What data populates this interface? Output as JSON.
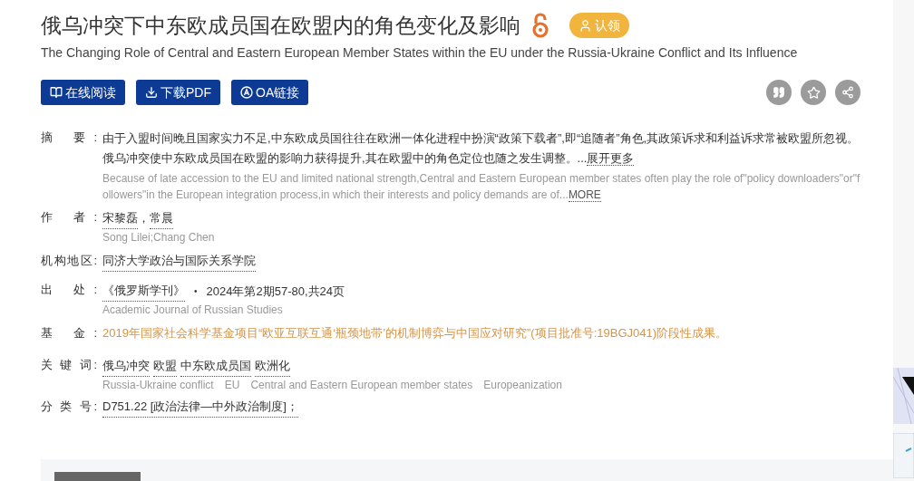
{
  "title": "俄乌冲突下中东欧成员国在欧盟内的角色变化及影响",
  "claim_badge": "认领",
  "subtitle": "The Changing Role of Central and Eastern European Member States within the EU under the Russia-Ukraine Conflict and Its Influence",
  "buttons": [
    {
      "kind": "read",
      "label": "在线阅读"
    },
    {
      "kind": "download",
      "label": "下载PDF"
    },
    {
      "kind": "oa",
      "label": "OA链接"
    }
  ],
  "fields": [
    {
      "kind": "abstract",
      "label": "摘 要:",
      "text": "由于入盟时间晚且国家实力不足,中东欧成员国往往在欧洲一体化进程中扮演“政策下载者”,即“追随者”角色,其政策诉求和利益诉求常被欧盟所忽视。俄乌冲突使中东欧成员国在欧盟的影响力获得提升,其在欧盟中的角色定位也随之发生调整。...",
      "more": "展开更多",
      "text_en": "Because of late accession to the EU and limited national strength,Central and Eastern European member states often play the role of\"policy downloaders\"or\"followers\"in the European integration process,in which their interests and policy demands are of...",
      "more_en": "MORE"
    },
    {
      "kind": "authors",
      "label": "作 者:",
      "authors": [
        "宋黎磊",
        "常晨"
      ],
      "separator": "，",
      "text_en": "Song Lilei;Chang Chen"
    },
    {
      "kind": "text",
      "label": "机构地区:",
      "text": "同济大学政治与国际关系学院"
    },
    {
      "kind": "source",
      "label": "出 处:",
      "journal": "《俄罗斯学刊》",
      "dot": "•",
      "issue": "2024年第2期57-80,共24页",
      "text_en": "Academic Journal of Russian Studies"
    },
    {
      "kind": "fund",
      "label": "基 金:",
      "text": "2019年国家社会科学基金项目“欧亚互联互通‘瓶颈地带’的机制博弈与中国应对研究”(项目批准号:19BGJ041)阶段性成果。"
    },
    {
      "kind": "keywords",
      "label": "关 键 词:",
      "keywords": [
        "俄乌冲突",
        "欧盟",
        "中东欧成员国",
        "欧洲化"
      ],
      "keywords_en": [
        "Russia-Ukraine conflict",
        "EU",
        "Central and Eastern European member states",
        "Europeanization"
      ]
    },
    {
      "kind": "classification",
      "label": "分 类 号:",
      "text": "D751.22 [政治法律—中外政治制度]；"
    }
  ]
}
